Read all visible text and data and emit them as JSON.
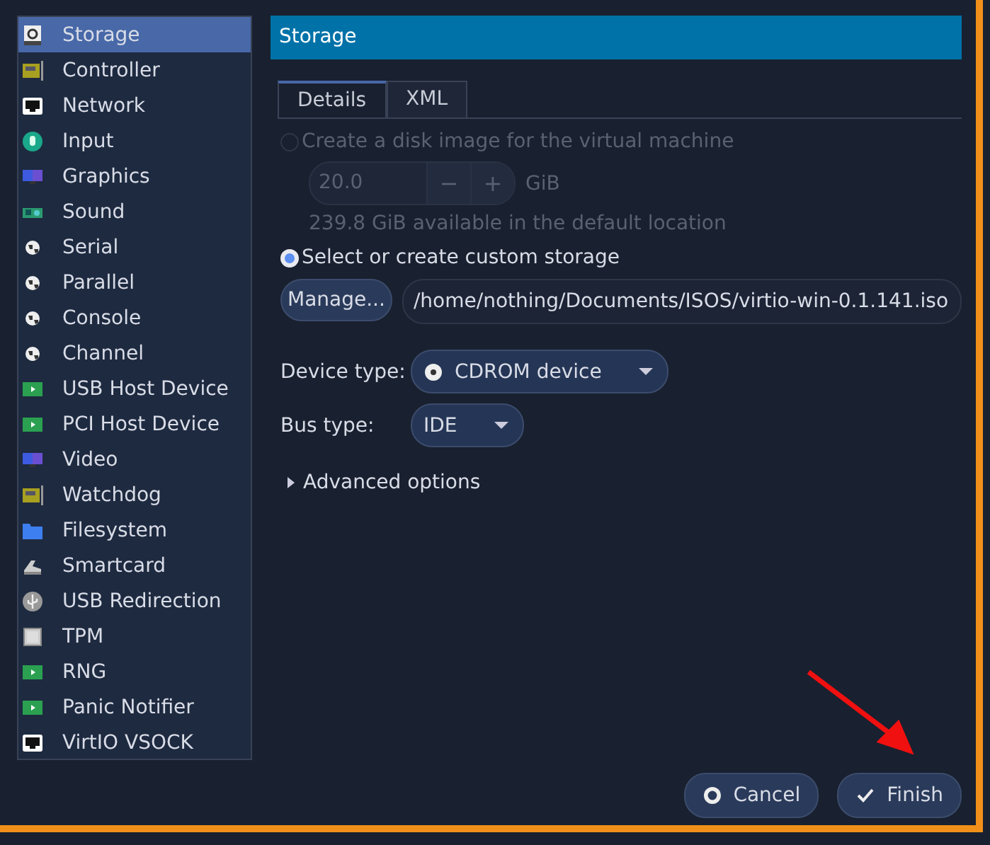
{
  "sidebar": {
    "items": [
      {
        "label": "Storage",
        "kind": "disk",
        "selected": true
      },
      {
        "label": "Controller",
        "kind": "card",
        "selected": false
      },
      {
        "label": "Network",
        "kind": "port",
        "selected": false
      },
      {
        "label": "Input",
        "kind": "mouse",
        "selected": false
      },
      {
        "label": "Graphics",
        "kind": "monitor",
        "selected": false
      },
      {
        "label": "Sound",
        "kind": "soundcard",
        "selected": false
      },
      {
        "label": "Serial",
        "kind": "globe",
        "selected": false
      },
      {
        "label": "Parallel",
        "kind": "globe",
        "selected": false
      },
      {
        "label": "Console",
        "kind": "globe",
        "selected": false
      },
      {
        "label": "Channel",
        "kind": "globe",
        "selected": false
      },
      {
        "label": "USB Host Device",
        "kind": "device",
        "selected": false
      },
      {
        "label": "PCI Host Device",
        "kind": "device",
        "selected": false
      },
      {
        "label": "Video",
        "kind": "monitor",
        "selected": false
      },
      {
        "label": "Watchdog",
        "kind": "card",
        "selected": false
      },
      {
        "label": "Filesystem",
        "kind": "folder",
        "selected": false
      },
      {
        "label": "Smartcard",
        "kind": "reader",
        "selected": false
      },
      {
        "label": "USB Redirection",
        "kind": "usb",
        "selected": false
      },
      {
        "label": "TPM",
        "kind": "chip",
        "selected": false
      },
      {
        "label": "RNG",
        "kind": "device",
        "selected": false
      },
      {
        "label": "Panic Notifier",
        "kind": "device",
        "selected": false
      },
      {
        "label": "VirtIO VSOCK",
        "kind": "port",
        "selected": false
      }
    ]
  },
  "header": {
    "title": "Storage"
  },
  "tabs": [
    {
      "label": "Details",
      "selected": true
    },
    {
      "label": "XML",
      "selected": false
    }
  ],
  "create_option": {
    "label": "Create a disk image for the virtual machine",
    "selected": false,
    "disabled": true,
    "size": {
      "value": "20.0",
      "minus": "−",
      "plus": "+",
      "unit": "GiB"
    },
    "note": "239.8 GiB available in the default location"
  },
  "custom_option": {
    "label": "Select or create custom storage",
    "selected": true,
    "disabled": false,
    "manage_button": "Manage...",
    "path": "/home/nothing/Documents/ISOS/virtio-win-0.1.141.iso"
  },
  "device_type": {
    "label": "Device type:",
    "value": "CDROM device"
  },
  "bus_type": {
    "label": "Bus type:",
    "value": "IDE"
  },
  "advanced": {
    "label": "Advanced options",
    "expanded": false
  },
  "buttons": {
    "cancel": "Cancel",
    "finish": "Finish"
  }
}
